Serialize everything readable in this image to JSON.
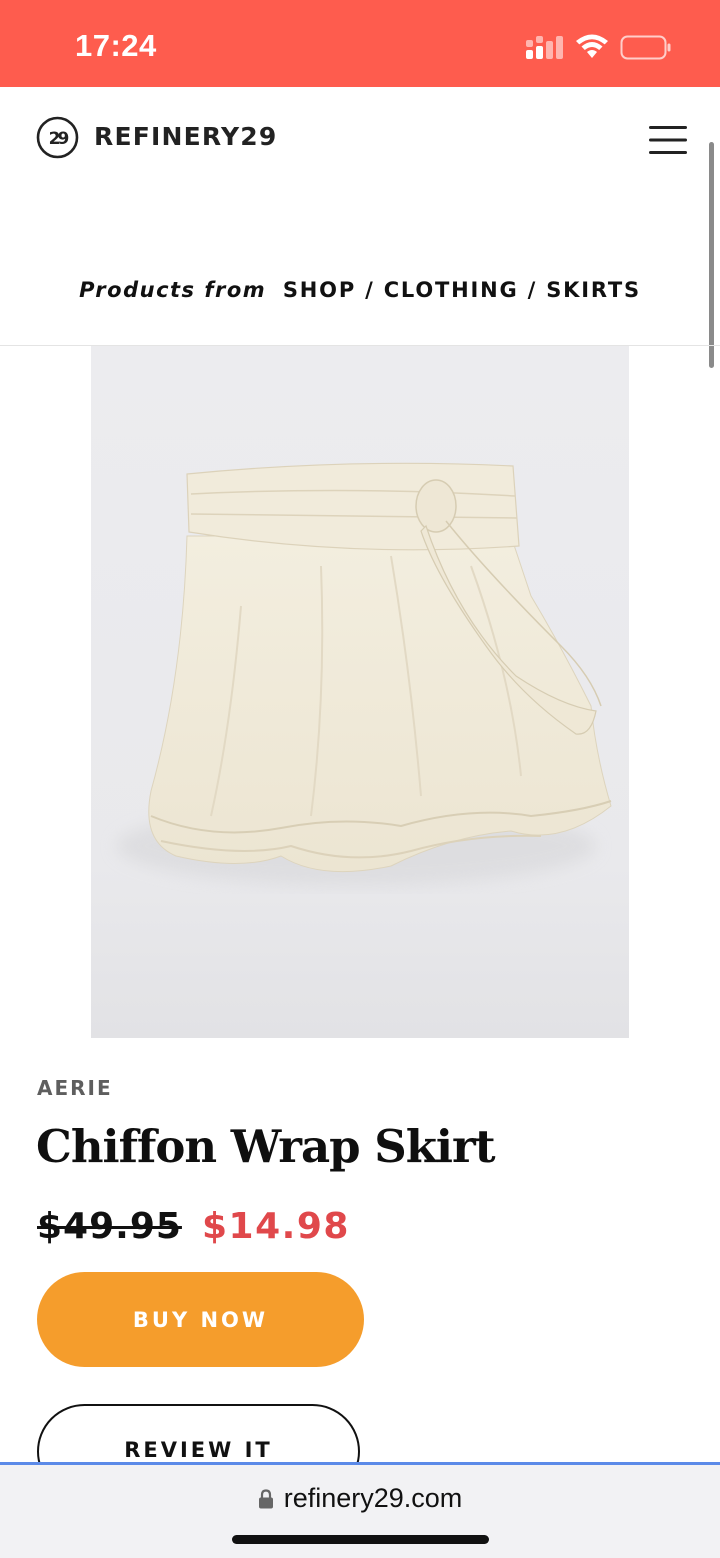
{
  "status_bar": {
    "time": "17:24"
  },
  "header": {
    "logo_text": "REFINERY29"
  },
  "breadcrumb": {
    "lead": "Products from",
    "path": "SHOP / CLOTHING / SKIRTS"
  },
  "product": {
    "brand": "AERIE",
    "title": "Chiffon Wrap Skirt",
    "original_price": "$49.95",
    "sale_price": "$14.98",
    "buy_label": "BUY NOW",
    "review_label": "REVIEW IT"
  },
  "browser": {
    "url": "refinery29.com"
  },
  "colors": {
    "status_bar": "#fe5c4e",
    "accent_orange": "#f59d2c",
    "sale_red": "#e0484b"
  }
}
